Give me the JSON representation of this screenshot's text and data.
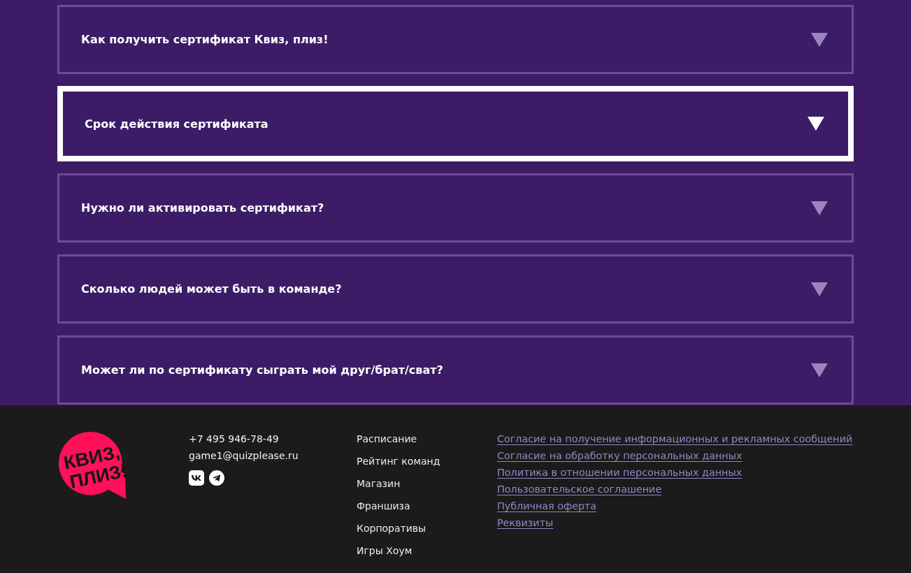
{
  "faq": {
    "items": [
      {
        "question": "Как получить сертификат Квиз, плиз!",
        "focused": false
      },
      {
        "question": "Срок действия сертификата",
        "focused": true
      },
      {
        "question": "Нужно ли активировать сертификат?",
        "focused": false
      },
      {
        "question": "Сколько людей может быть в команде?",
        "focused": false
      },
      {
        "question": "Может ли по сертификату сыграть мой друг/брат/сват?",
        "focused": false
      }
    ]
  },
  "footer": {
    "logo": {
      "lines": [
        "КВИЗ,",
        "ПЛИЗ!"
      ]
    },
    "contacts": {
      "phone": "+7 495 946-78-49",
      "email": "game1@quizplease.ru",
      "social": [
        {
          "kind": "vk"
        },
        {
          "kind": "telegram"
        }
      ]
    },
    "nav": [
      "Расписание",
      "Рейтинг команд",
      "Магазин",
      "Франшиза",
      "Корпоративы",
      "Игры Хоум"
    ],
    "legal_links": [
      "Согласие на получение информационных и рекламных сообщений",
      "Согласие на обработку персональных данных",
      "Политика в отношении персональных данных",
      "Пользовательское соглашение",
      "Публичная оферта",
      "Реквизиты"
    ]
  }
}
